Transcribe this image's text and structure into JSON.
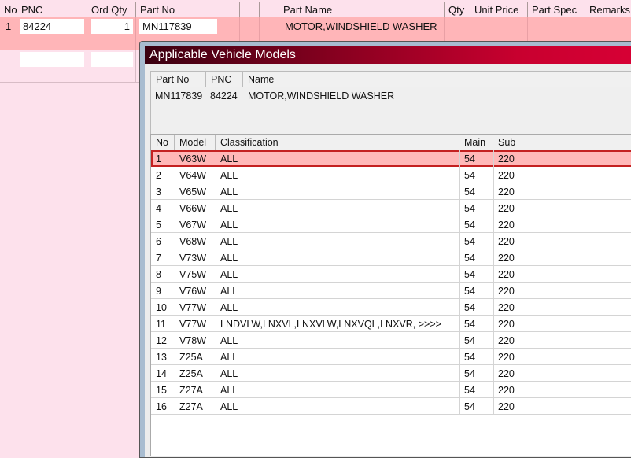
{
  "grid": {
    "headers": [
      "No",
      "PNC",
      "Ord Qty",
      "Part No",
      "",
      "",
      "",
      "Part Name",
      "Qty",
      "Unit Price",
      "Part Spec",
      "Remarks"
    ],
    "rows": [
      {
        "no": "1",
        "pnc": "84224",
        "ord_qty": "1",
        "part_no": "MN117839",
        "part_name": "MOTOR,WINDSHIELD WASHER"
      }
    ]
  },
  "dialog": {
    "title": "Applicable Vehicle Models",
    "part_headers": [
      "Part No",
      "PNC",
      "Name"
    ],
    "part": {
      "part_no": "MN117839",
      "pnc": "84224",
      "name": "MOTOR,WINDSHIELD WASHER"
    },
    "model_headers": [
      "No",
      "Model",
      "Classification",
      "Main",
      "Sub"
    ],
    "models": [
      [
        "1",
        "V63W",
        "ALL",
        "54",
        "220"
      ],
      [
        "2",
        "V64W",
        "ALL",
        "54",
        "220"
      ],
      [
        "3",
        "V65W",
        "ALL",
        "54",
        "220"
      ],
      [
        "4",
        "V66W",
        "ALL",
        "54",
        "220"
      ],
      [
        "5",
        "V67W",
        "ALL",
        "54",
        "220"
      ],
      [
        "6",
        "V68W",
        "ALL",
        "54",
        "220"
      ],
      [
        "7",
        "V73W",
        "ALL",
        "54",
        "220"
      ],
      [
        "8",
        "V75W",
        "ALL",
        "54",
        "220"
      ],
      [
        "9",
        "V76W",
        "ALL",
        "54",
        "220"
      ],
      [
        "10",
        "V77W",
        "ALL",
        "54",
        "220"
      ],
      [
        "11",
        "V77W",
        "LNDVLW,LNXVL,LNXVLW,LNXVQL,LNXVR,  >>>>",
        "54",
        "220"
      ],
      [
        "12",
        "V78W",
        "ALL",
        "54",
        "220"
      ],
      [
        "13",
        "Z25A",
        "ALL",
        "54",
        "220"
      ],
      [
        "14",
        "Z25A",
        "ALL",
        "54",
        "220"
      ],
      [
        "15",
        "Z27A",
        "ALL",
        "54",
        "220"
      ],
      [
        "16",
        "Z27A",
        "ALL",
        "54",
        "220"
      ]
    ],
    "selected_row": 1,
    "colors": {
      "selected": "#ffb8b8",
      "selected_border": "#c42020"
    }
  }
}
